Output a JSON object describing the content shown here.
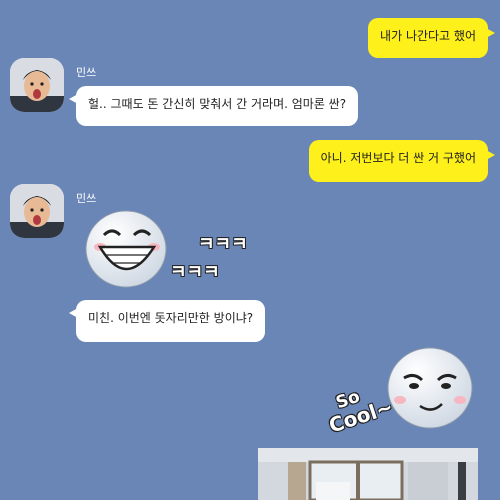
{
  "messages": {
    "m1": "내가 나간다고 했어",
    "m2": "헐.. 그때도 돈 간신히 맞춰서 간 거라며. 엄마론 싼?",
    "m3": "아니. 저번보다 더 싼 거 구했어",
    "m4": "미친. 이번엔 돗자리만한 방이냐?"
  },
  "sender": {
    "name": "민쓰"
  },
  "stickers": {
    "laugh_text_1": "ㅋㅋㅋ",
    "laugh_text_2": "ㅋㅋㅋ",
    "cool_text_1": "So",
    "cool_text_2": "Cool~"
  },
  "colors": {
    "background": "#6a86b6",
    "my_bubble": "#fef01b",
    "their_bubble": "#ffffff"
  }
}
